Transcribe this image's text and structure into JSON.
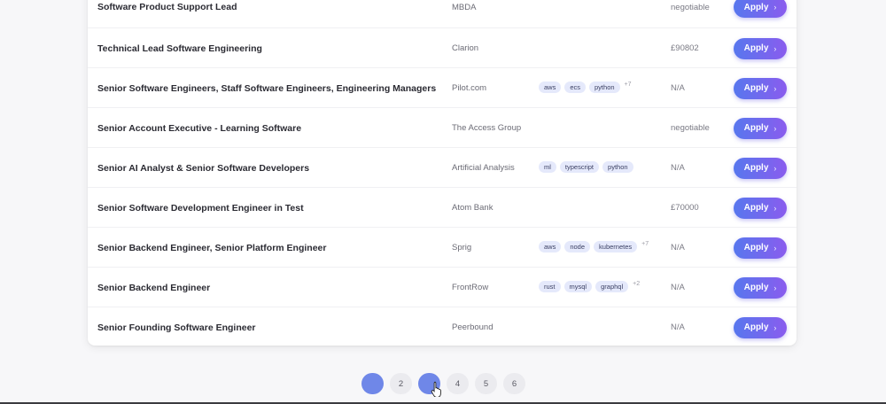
{
  "jobs": [
    {
      "title": "Software Product Support Lead",
      "company": "MBDA",
      "tags": [],
      "more": "",
      "salary": "negotiable",
      "apply": "Apply"
    },
    {
      "title": "Technical Lead Software Engineering",
      "company": "Clarion",
      "tags": [],
      "more": "",
      "salary": "£90802",
      "apply": "Apply"
    },
    {
      "title": "Senior Software Engineers, Staff Software Engineers, Engineering Managers",
      "company": "Pilot.com",
      "tags": [
        "aws",
        "ecs",
        "python"
      ],
      "more": "+7",
      "salary": "N/A",
      "apply": "Apply"
    },
    {
      "title": "Senior Account Executive - Learning Software",
      "company": "The Access Group",
      "tags": [],
      "more": "",
      "salary": "negotiable",
      "apply": "Apply"
    },
    {
      "title": "Senior AI Analyst & Senior Software Developers",
      "company": "Artificial Analysis",
      "tags": [
        "ml",
        "typescript",
        "python"
      ],
      "more": "",
      "salary": "N/A",
      "apply": "Apply"
    },
    {
      "title": "Senior Software Development Engineer in Test",
      "company": "Atom Bank",
      "tags": [],
      "more": "",
      "salary": "£70000",
      "apply": "Apply"
    },
    {
      "title": "Senior Backend Engineer, Senior Platform Engineer",
      "company": "Sprig",
      "tags": [
        "aws",
        "node",
        "kubernetes"
      ],
      "more": "+7",
      "salary": "N/A",
      "apply": "Apply"
    },
    {
      "title": "Senior Backend Engineer",
      "company": "FrontRow",
      "tags": [
        "rust",
        "mysql",
        "graphql"
      ],
      "more": "+2",
      "salary": "N/A",
      "apply": "Apply"
    },
    {
      "title": "Senior Founding Software Engineer",
      "company": "Peerbound",
      "tags": [],
      "more": "",
      "salary": "N/A",
      "apply": "Apply"
    }
  ],
  "pagination": {
    "pages": [
      "1",
      "2",
      "3",
      "4",
      "5",
      "6"
    ],
    "current": "1",
    "hovered": "3"
  },
  "icons": {
    "apply_chevron": "chevron-right-icon",
    "cursor": "hand-pointer-icon"
  },
  "colors": {
    "accent_start": "#5777ee",
    "accent_end": "#8a5cee",
    "tag_bg": "#e5e9fb",
    "page_active": "#6f87e8"
  }
}
